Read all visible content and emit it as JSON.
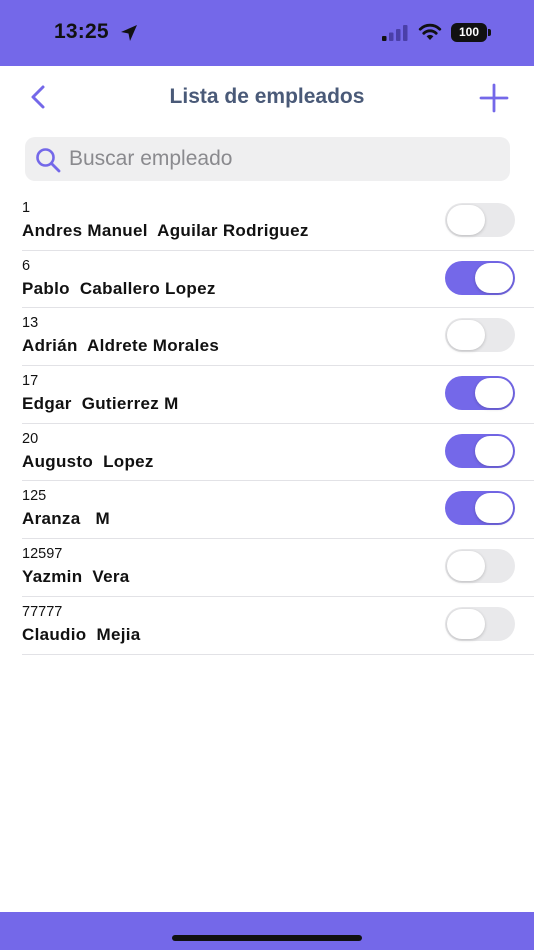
{
  "status_bar": {
    "time": "13:25",
    "battery": "100",
    "color": "#7468e9"
  },
  "nav": {
    "title": "Lista de empleados",
    "back_icon": "chevron-left-icon",
    "add_icon": "plus-icon"
  },
  "search": {
    "placeholder": "Buscar empleado",
    "value": ""
  },
  "employees": [
    {
      "id": "1",
      "name": "Andres Manuel  Aguilar Rodriguez",
      "enabled": false
    },
    {
      "id": "6",
      "name": "Pablo  Caballero Lopez",
      "enabled": true
    },
    {
      "id": "13",
      "name": "Adrián  Aldrete Morales",
      "enabled": false
    },
    {
      "id": "17",
      "name": "Edgar  Gutierrez M",
      "enabled": true
    },
    {
      "id": "20",
      "name": "Augusto  Lopez",
      "enabled": true
    },
    {
      "id": "125",
      "name": "Aranza   M",
      "enabled": true
    },
    {
      "id": "12597",
      "name": "Yazmin  Vera",
      "enabled": false
    },
    {
      "id": "77777",
      "name": "Claudio  Mejia",
      "enabled": false
    }
  ],
  "colors": {
    "accent": "#7468e9",
    "title": "#4a5a78",
    "toggle_off": "#e9e9eb"
  }
}
